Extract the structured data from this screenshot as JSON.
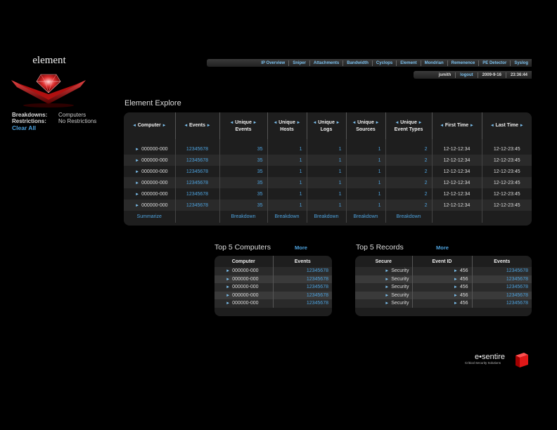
{
  "app": {
    "logo_text": "element"
  },
  "filters": {
    "breakdowns_label": "Breakdowns:",
    "breakdowns_value": "Computers",
    "restrictions_label": "Restrictions:",
    "restrictions_value": "No Restrictions",
    "clear_all": "Clear All"
  },
  "nav": {
    "items": [
      "IP Overview",
      "Sniper",
      "Attachments",
      "Bandwidth",
      "Cyclops",
      "Element",
      "Mondrian",
      "Remenence",
      "PE Detector",
      "Syslog"
    ]
  },
  "userbar": {
    "user": "jsmith",
    "logout": "logout",
    "date": "2009-9-16",
    "time": "23:36:44"
  },
  "explore": {
    "title": "Element Explore",
    "headers": [
      {
        "line1": "Computer",
        "line2": ""
      },
      {
        "line1": "Events",
        "line2": ""
      },
      {
        "line1": "Unique",
        "line2": "Events"
      },
      {
        "line1": "Unique",
        "line2": "Hosts"
      },
      {
        "line1": "Unique",
        "line2": "Logs"
      },
      {
        "line1": "Unique",
        "line2": "Sources"
      },
      {
        "line1": "Unique",
        "line2": "Event Types"
      },
      {
        "line1": "First Time",
        "line2": ""
      },
      {
        "line1": "Last Time",
        "line2": ""
      }
    ],
    "rows": [
      [
        "000000-000",
        "12345678",
        "35",
        "1",
        "1",
        "1",
        "2",
        "12-12-12:34",
        "12-12-23:45"
      ],
      [
        "000000-000",
        "12345678",
        "35",
        "1",
        "1",
        "1",
        "2",
        "12-12-12:34",
        "12-12-23:45"
      ],
      [
        "000000-000",
        "12345678",
        "35",
        "1",
        "1",
        "1",
        "2",
        "12-12-12:34",
        "12-12-23:45"
      ],
      [
        "000000-000",
        "12345678",
        "35",
        "1",
        "1",
        "1",
        "2",
        "12-12-12:34",
        "12-12-23:45"
      ],
      [
        "000000-000",
        "12345678",
        "35",
        "1",
        "1",
        "1",
        "2",
        "12-12-12:34",
        "12-12-23:45"
      ],
      [
        "000000-000",
        "12345678",
        "35",
        "1",
        "1",
        "1",
        "2",
        "12-12-12:34",
        "12-12-23:45"
      ]
    ],
    "footer": [
      "Summarize",
      "",
      "Breakdown",
      "Breakdown",
      "Breakdown",
      "Breakdown",
      "Breakdown",
      "",
      ""
    ]
  },
  "top5_computers": {
    "title": "Top 5 Computers",
    "more": "More",
    "headers": [
      "Computer",
      "Events"
    ],
    "rows": [
      [
        "000000-000",
        "12345678"
      ],
      [
        "000000-000",
        "12345678"
      ],
      [
        "000000-000",
        "12345678"
      ],
      [
        "000000-000",
        "12345678"
      ],
      [
        "000000-000",
        "12345678"
      ]
    ]
  },
  "top5_records": {
    "title": "Top 5 Records",
    "more": "More",
    "headers": [
      "Secure",
      "Event ID",
      "Events"
    ],
    "rows": [
      [
        "Security",
        "456",
        "12345678"
      ],
      [
        "Security",
        "456",
        "12345678"
      ],
      [
        "Security",
        "456",
        "12345678"
      ],
      [
        "Security",
        "456",
        "12345678"
      ],
      [
        "Security",
        "456",
        "12345678"
      ]
    ]
  },
  "brand": {
    "name": "e•sentire",
    "tagline": "Critical Security Solutions"
  },
  "colors": {
    "accent": "#4ea3df",
    "background": "#000000",
    "panel": "#1e1e1e"
  }
}
